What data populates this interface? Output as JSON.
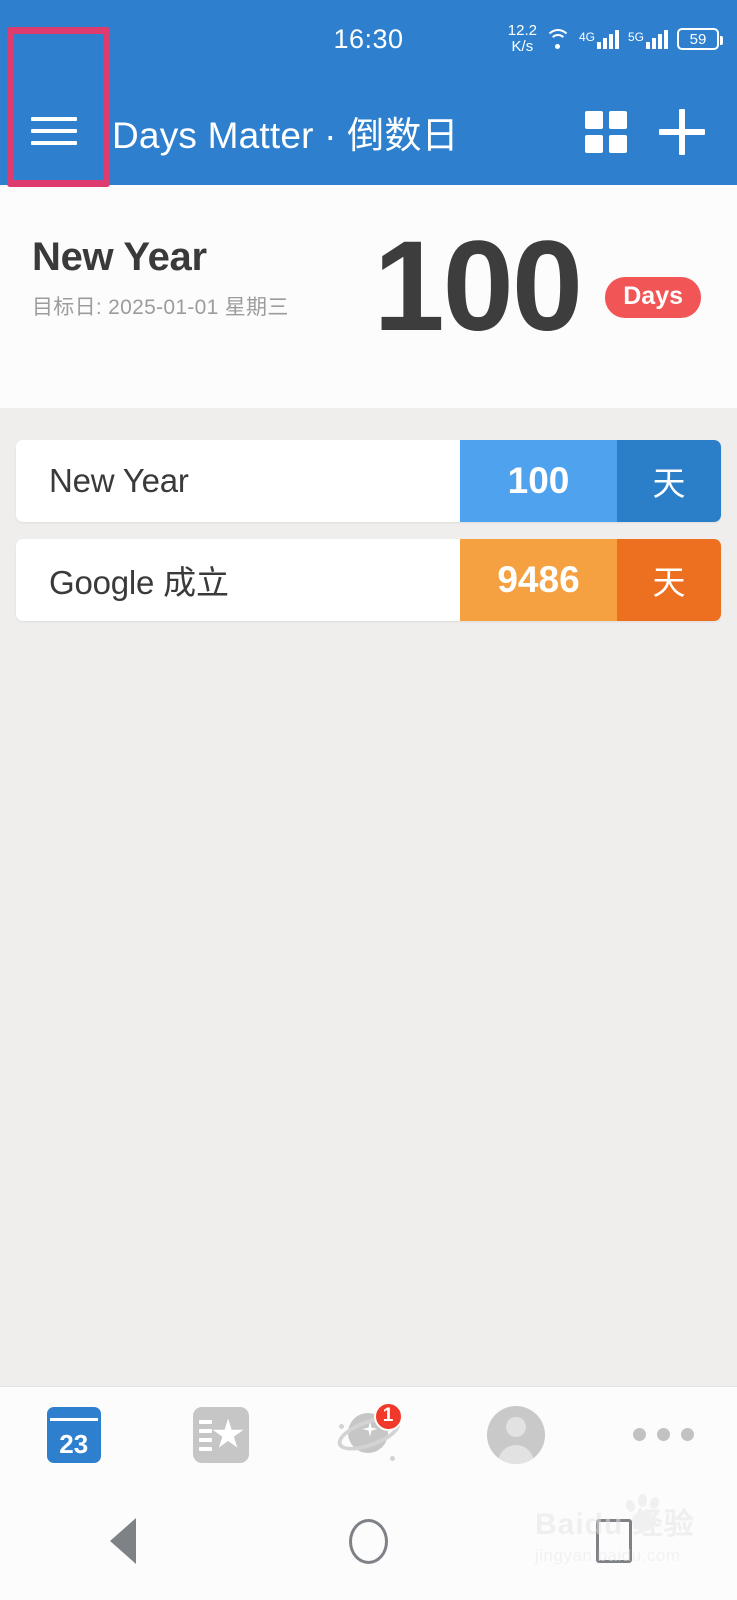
{
  "statusbar": {
    "clock": "16:30",
    "network_speed_value": "12.2",
    "network_speed_unit": "K/s",
    "wifi_icon": "wifi-icon",
    "sim1_label": "4G",
    "sim2_label": "5G",
    "battery_level": "59"
  },
  "appbar": {
    "menu_icon": "hamburger-menu-icon",
    "title": "Days Matter · 倒数日",
    "grid_icon": "grid-view-icon",
    "add_icon": "plus-add-icon",
    "highlight_color": "#DE3B6E",
    "background_color": "#2E80CE"
  },
  "hero": {
    "title": "New Year",
    "subtitle": "目标日: 2025-01-01 星期三",
    "days_number": "100",
    "badge_label": "Days",
    "badge_color": "#F25555"
  },
  "list": {
    "items": [
      {
        "name": "New Year",
        "count": "100",
        "unit": "天",
        "count_color": "#4FA3EE",
        "unit_color": "#2B7FC9"
      },
      {
        "name": "Google 成立",
        "count": "9486",
        "unit": "天",
        "count_color": "#F5A142",
        "unit_color": "#ED6F20"
      }
    ]
  },
  "tabbar": {
    "items": [
      {
        "icon": "calendar-icon",
        "calendar_day": "23",
        "badge": ""
      },
      {
        "icon": "bookmark-star-icon",
        "badge": ""
      },
      {
        "icon": "planet-icon",
        "badge": "1"
      },
      {
        "icon": "user-avatar-icon",
        "badge": ""
      },
      {
        "icon": "more-dots-icon",
        "badge": ""
      }
    ]
  },
  "navbar": {
    "back_icon": "back-triangle-icon",
    "home_icon": "home-circle-icon",
    "recent_icon": "recents-square-icon"
  },
  "watermark": {
    "main": "Baidu 经验",
    "sub": "jingyan.baidu.com"
  }
}
